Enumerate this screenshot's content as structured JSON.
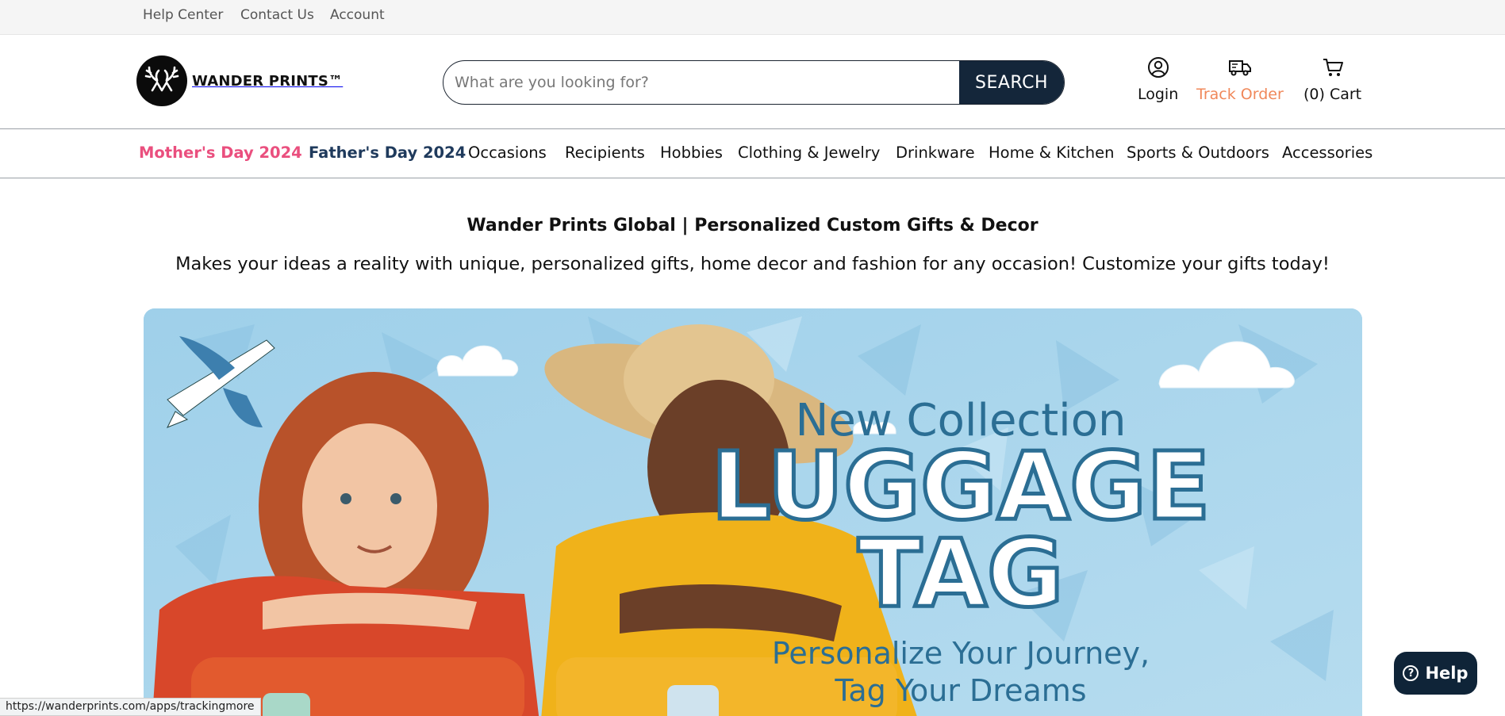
{
  "topbar": {
    "links": [
      "Help Center",
      "Contact Us",
      "Account"
    ]
  },
  "header": {
    "logo_text": "WANDER PRINTS™",
    "search": {
      "placeholder": "What are you looking for?",
      "value": "",
      "button_label": "SEARCH"
    },
    "actions": {
      "login": "Login",
      "track_order": "Track Order",
      "cart": "(0) Cart"
    },
    "colors": {
      "track_order": "#f0885a",
      "search_button": "#14263a"
    }
  },
  "nav": {
    "items": [
      "Mother's Day 2024",
      "Father's Day 2024",
      "Occasions",
      "Recipients",
      "Hobbies",
      "Clothing & Jewelry",
      "Drinkware",
      "Home & Kitchen",
      "Sports & Outdoors",
      "Accessories"
    ],
    "colors": {
      "mothers_day": "#ea4f7e",
      "fathers_day": "#1f3a5c"
    }
  },
  "intro": {
    "title": "Wander Prints Global | Personalized Custom Gifts & Decor",
    "subtitle": "Makes your ideas a reality with unique, personalized gifts, home decor and fashion for any occasion! Customize your gifts today!"
  },
  "banner": {
    "line1": "New Collection",
    "line2": "LUGGAGE",
    "line3": "TAG",
    "line4": "Personalize Your Journey,",
    "line5": "Tag Your Dreams"
  },
  "help_button": {
    "label": "Help"
  },
  "status_bar": {
    "url": "https://wanderprints.com/apps/trackingmore"
  }
}
